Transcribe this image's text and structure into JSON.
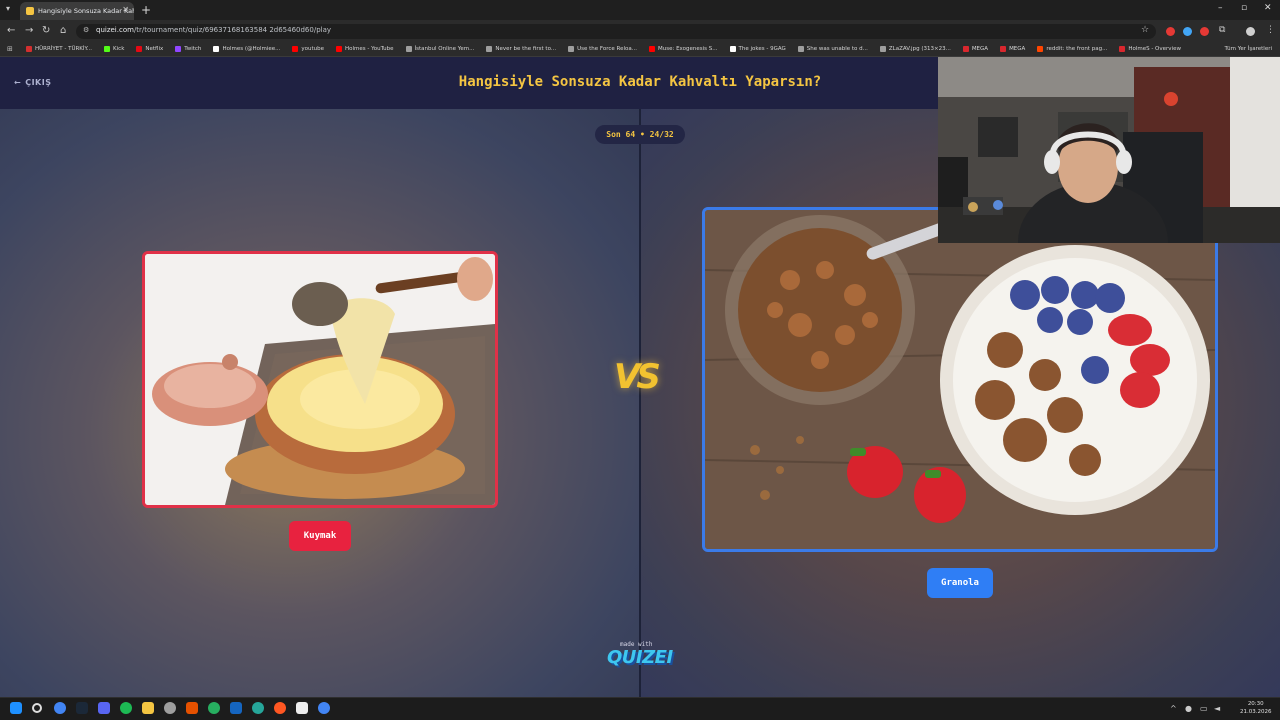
{
  "browser": {
    "tab_title": "Hangisiyle Sonsuza Kadar Kahv",
    "url_host": "quizei.com",
    "url_path": "/tr/tournament/quiz/69637168163584 2d65460d60/play",
    "bookmarks": [
      {
        "label": "HÜRRİYET - TÜRKİY...",
        "color": "#d32f2f"
      },
      {
        "label": "Kick",
        "color": "#53fc18"
      },
      {
        "label": "Netflix",
        "color": "#e50914"
      },
      {
        "label": "Twitch",
        "color": "#9146ff"
      },
      {
        "label": "Holmes (@Holmiee...",
        "color": "#ffffff"
      },
      {
        "label": "youtube",
        "color": "#ff0000"
      },
      {
        "label": "Holmes - YouTube",
        "color": "#ff0000"
      },
      {
        "label": "İstanbul Online Yem...",
        "color": "#9e9e9e"
      },
      {
        "label": "Never be the first to...",
        "color": "#9e9e9e"
      },
      {
        "label": "Use the Force Reloa...",
        "color": "#9e9e9e"
      },
      {
        "label": "Muse: Exogenesis S...",
        "color": "#ff0000"
      },
      {
        "label": "The jokes - 9GAG",
        "color": "#ffffff"
      },
      {
        "label": "She was unable to d...",
        "color": "#9e9e9e"
      },
      {
        "label": "ZLaZAV.jpg (313×23...",
        "color": "#9e9e9e"
      },
      {
        "label": "MEGA",
        "color": "#d9272e"
      },
      {
        "label": "MEGA",
        "color": "#d9272e"
      },
      {
        "label": "reddit: the front pag...",
        "color": "#ff4500"
      },
      {
        "label": "HolmeS - Overview",
        "color": "#d9272e"
      }
    ],
    "all_bookmarks": "Tüm Yer İşaretleri"
  },
  "quiz": {
    "back_label": "ÇIKIŞ",
    "title": "Hangisiyle Sonsuza Kadar Kahvaltı Yaparsın?",
    "round": "Son 64 • 24/32",
    "left_choice": "Kuymak",
    "right_choice": "Granola",
    "vs": "VS",
    "made_with": "made with",
    "brand": "QUIZEI"
  },
  "taskbar": {
    "time": "20:30",
    "date": "21.03.2026"
  },
  "colors": {
    "title": "#f4c542",
    "left_accent": "#e8223f",
    "right_accent": "#2f7ef5",
    "header_bg": "#1f2142"
  }
}
